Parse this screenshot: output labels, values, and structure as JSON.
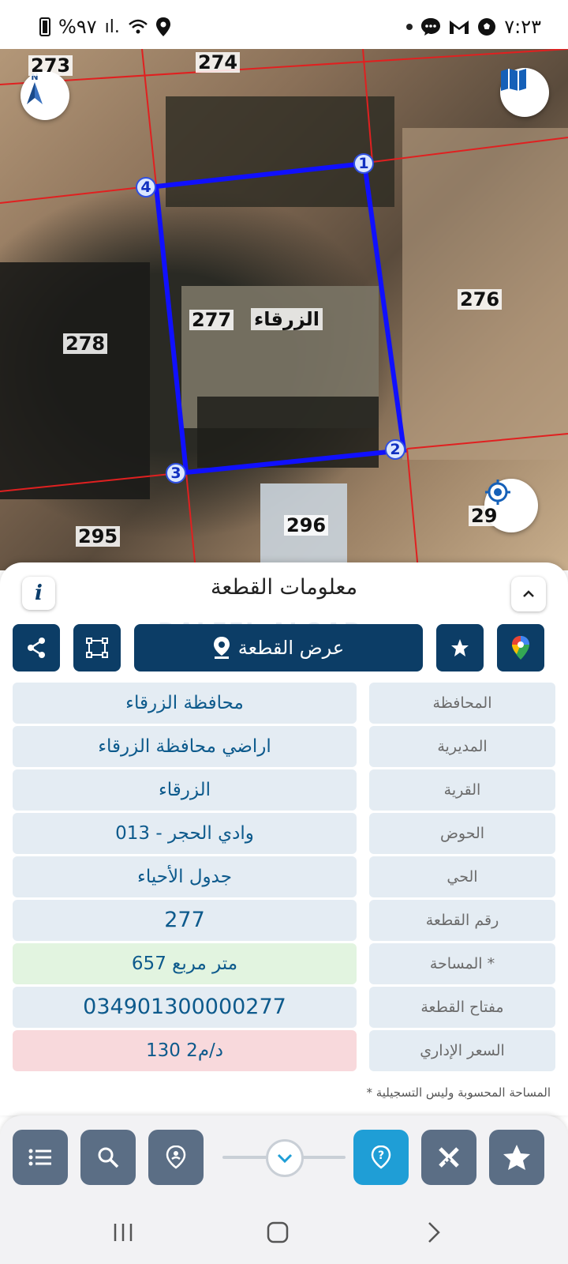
{
  "status_bar": {
    "battery": "%٩٧",
    "time": "٧:٢٣"
  },
  "map": {
    "parcel_numbers": {
      "p273": "273",
      "p274": "274",
      "p276": "276",
      "p277": "277",
      "p278": "278",
      "p295": "295",
      "p296": "296",
      "p29x": "29"
    },
    "place_label": "الزرقاء",
    "vertices": [
      "1",
      "2",
      "3",
      "4"
    ],
    "compass_label": "N",
    "colors": {
      "parcel_outline": "#1010ff",
      "boundary_lines": "#e02020"
    }
  },
  "panel": {
    "title": "معلومات القطعة",
    "info_label": "i",
    "show_parcel_label": "عرض القطعة",
    "watermark": "DALEEL ALQAD",
    "rows": [
      {
        "label": "المحافظة",
        "value": "محافظة الزرقاء"
      },
      {
        "label": "المديرية",
        "value": "اراضي محافظة الزرقاء"
      },
      {
        "label": "القرية",
        "value": "الزرقاء"
      },
      {
        "label": "الحوض",
        "value": "وادي الحجر - 013"
      },
      {
        "label": "الحي",
        "value": "جدول الأحياء"
      },
      {
        "label": "رقم القطعة",
        "value": "277"
      },
      {
        "label": "المساحة *",
        "value": "657  متر مربع"
      },
      {
        "label": "مفتاح القطعة",
        "value": "034901300000277"
      },
      {
        "label": "السعر الإداري",
        "value": "130 د/م2"
      }
    ],
    "footnote": "* المساحة المحسوبة وليس التسجيلية",
    "colors": {
      "primary": "#0c3d66",
      "value_text": "#0d5a8c",
      "area_bg": "#e2f4e0",
      "price_bg": "#f8d9dc"
    }
  },
  "toolbar": {
    "icons": [
      "list-icon",
      "search-icon",
      "location-pin-icon",
      "chevron-down-icon",
      "help-pin-icon",
      "measure-icon",
      "star-icon"
    ],
    "active_color": "#1f9ed6"
  }
}
